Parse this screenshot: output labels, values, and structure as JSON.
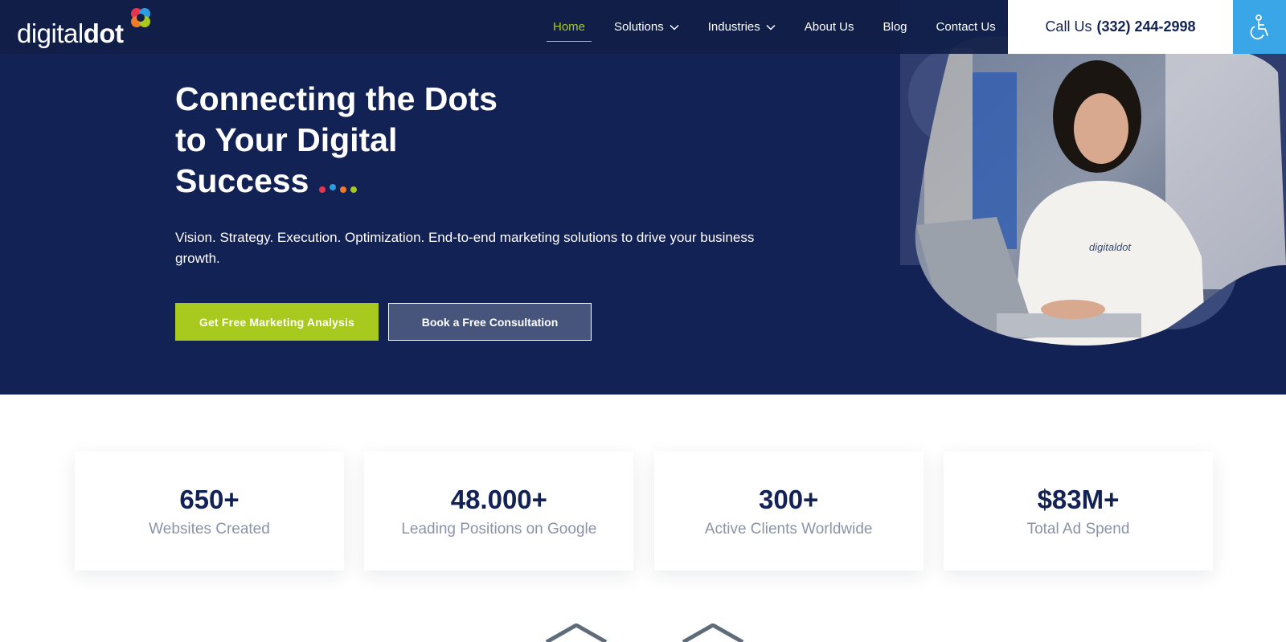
{
  "header": {
    "logo": {
      "light": "digital",
      "bold": "dot"
    },
    "nav": [
      {
        "label": "Home",
        "active": true,
        "dropdown": false
      },
      {
        "label": "Solutions",
        "active": false,
        "dropdown": true
      },
      {
        "label": "Industries",
        "active": false,
        "dropdown": true
      },
      {
        "label": "About Us",
        "active": false,
        "dropdown": false
      },
      {
        "label": "Blog",
        "active": false,
        "dropdown": false
      },
      {
        "label": "Contact Us",
        "active": false,
        "dropdown": false
      }
    ],
    "call": {
      "label": "Call Us",
      "number": "(332) 244-2998"
    },
    "accessibility_icon": "wheelchair-icon"
  },
  "hero": {
    "title_lines": [
      "Connecting the Dots",
      "to Your Digital",
      "Success"
    ],
    "subtitle": "Vision. Strategy. Execution. Optimization. End-to-end marketing solutions to drive your business growth.",
    "primary_button": "Get Free Marketing Analysis",
    "secondary_button": "Book a Free Consultation",
    "shirt_logo": "digitaldot"
  },
  "stats": [
    {
      "value": "650+",
      "label": "Websites Created"
    },
    {
      "value": "48.000+",
      "label": "Leading Positions on Google"
    },
    {
      "value": "300+",
      "label": "Active Clients Worldwide"
    },
    {
      "value": "$83M+",
      "label": "Total Ad Spend"
    }
  ],
  "colors": {
    "navy": "#132255",
    "accent_green": "#a8c91e",
    "accessibility_blue": "#3aa6e8",
    "dot_red": "#e8344e",
    "dot_blue": "#2f9be0",
    "dot_orange": "#f07a2a",
    "dot_green": "#a8c91e"
  }
}
